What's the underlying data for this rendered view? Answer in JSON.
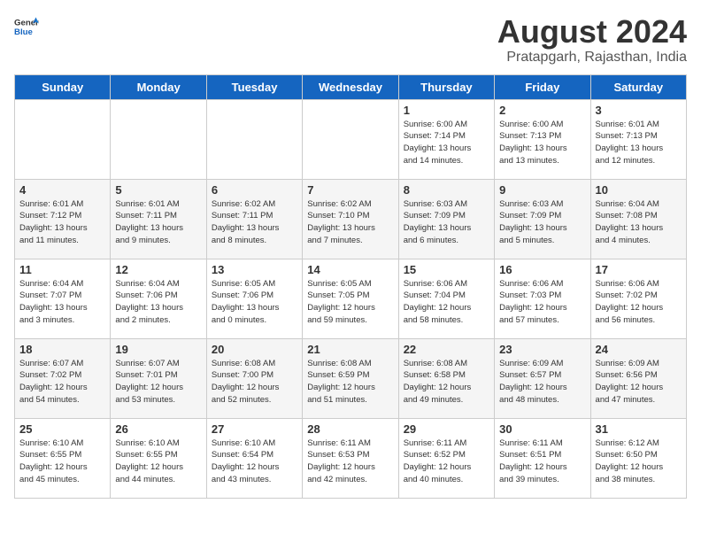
{
  "header": {
    "logo_general": "General",
    "logo_blue": "Blue",
    "title": "August 2024",
    "subtitle": "Pratapgarh, Rajasthan, India"
  },
  "days_of_week": [
    "Sunday",
    "Monday",
    "Tuesday",
    "Wednesday",
    "Thursday",
    "Friday",
    "Saturday"
  ],
  "rows": [
    {
      "alt": false,
      "cells": [
        {
          "day": "",
          "info": ""
        },
        {
          "day": "",
          "info": ""
        },
        {
          "day": "",
          "info": ""
        },
        {
          "day": "",
          "info": ""
        },
        {
          "day": "1",
          "info": "Sunrise: 6:00 AM\nSunset: 7:14 PM\nDaylight: 13 hours\nand 14 minutes."
        },
        {
          "day": "2",
          "info": "Sunrise: 6:00 AM\nSunset: 7:13 PM\nDaylight: 13 hours\nand 13 minutes."
        },
        {
          "day": "3",
          "info": "Sunrise: 6:01 AM\nSunset: 7:13 PM\nDaylight: 13 hours\nand 12 minutes."
        }
      ]
    },
    {
      "alt": true,
      "cells": [
        {
          "day": "4",
          "info": "Sunrise: 6:01 AM\nSunset: 7:12 PM\nDaylight: 13 hours\nand 11 minutes."
        },
        {
          "day": "5",
          "info": "Sunrise: 6:01 AM\nSunset: 7:11 PM\nDaylight: 13 hours\nand 9 minutes."
        },
        {
          "day": "6",
          "info": "Sunrise: 6:02 AM\nSunset: 7:11 PM\nDaylight: 13 hours\nand 8 minutes."
        },
        {
          "day": "7",
          "info": "Sunrise: 6:02 AM\nSunset: 7:10 PM\nDaylight: 13 hours\nand 7 minutes."
        },
        {
          "day": "8",
          "info": "Sunrise: 6:03 AM\nSunset: 7:09 PM\nDaylight: 13 hours\nand 6 minutes."
        },
        {
          "day": "9",
          "info": "Sunrise: 6:03 AM\nSunset: 7:09 PM\nDaylight: 13 hours\nand 5 minutes."
        },
        {
          "day": "10",
          "info": "Sunrise: 6:04 AM\nSunset: 7:08 PM\nDaylight: 13 hours\nand 4 minutes."
        }
      ]
    },
    {
      "alt": false,
      "cells": [
        {
          "day": "11",
          "info": "Sunrise: 6:04 AM\nSunset: 7:07 PM\nDaylight: 13 hours\nand 3 minutes."
        },
        {
          "day": "12",
          "info": "Sunrise: 6:04 AM\nSunset: 7:06 PM\nDaylight: 13 hours\nand 2 minutes."
        },
        {
          "day": "13",
          "info": "Sunrise: 6:05 AM\nSunset: 7:06 PM\nDaylight: 13 hours\nand 0 minutes."
        },
        {
          "day": "14",
          "info": "Sunrise: 6:05 AM\nSunset: 7:05 PM\nDaylight: 12 hours\nand 59 minutes."
        },
        {
          "day": "15",
          "info": "Sunrise: 6:06 AM\nSunset: 7:04 PM\nDaylight: 12 hours\nand 58 minutes."
        },
        {
          "day": "16",
          "info": "Sunrise: 6:06 AM\nSunset: 7:03 PM\nDaylight: 12 hours\nand 57 minutes."
        },
        {
          "day": "17",
          "info": "Sunrise: 6:06 AM\nSunset: 7:02 PM\nDaylight: 12 hours\nand 56 minutes."
        }
      ]
    },
    {
      "alt": true,
      "cells": [
        {
          "day": "18",
          "info": "Sunrise: 6:07 AM\nSunset: 7:02 PM\nDaylight: 12 hours\nand 54 minutes."
        },
        {
          "day": "19",
          "info": "Sunrise: 6:07 AM\nSunset: 7:01 PM\nDaylight: 12 hours\nand 53 minutes."
        },
        {
          "day": "20",
          "info": "Sunrise: 6:08 AM\nSunset: 7:00 PM\nDaylight: 12 hours\nand 52 minutes."
        },
        {
          "day": "21",
          "info": "Sunrise: 6:08 AM\nSunset: 6:59 PM\nDaylight: 12 hours\nand 51 minutes."
        },
        {
          "day": "22",
          "info": "Sunrise: 6:08 AM\nSunset: 6:58 PM\nDaylight: 12 hours\nand 49 minutes."
        },
        {
          "day": "23",
          "info": "Sunrise: 6:09 AM\nSunset: 6:57 PM\nDaylight: 12 hours\nand 48 minutes."
        },
        {
          "day": "24",
          "info": "Sunrise: 6:09 AM\nSunset: 6:56 PM\nDaylight: 12 hours\nand 47 minutes."
        }
      ]
    },
    {
      "alt": false,
      "cells": [
        {
          "day": "25",
          "info": "Sunrise: 6:10 AM\nSunset: 6:55 PM\nDaylight: 12 hours\nand 45 minutes."
        },
        {
          "day": "26",
          "info": "Sunrise: 6:10 AM\nSunset: 6:55 PM\nDaylight: 12 hours\nand 44 minutes."
        },
        {
          "day": "27",
          "info": "Sunrise: 6:10 AM\nSunset: 6:54 PM\nDaylight: 12 hours\nand 43 minutes."
        },
        {
          "day": "28",
          "info": "Sunrise: 6:11 AM\nSunset: 6:53 PM\nDaylight: 12 hours\nand 42 minutes."
        },
        {
          "day": "29",
          "info": "Sunrise: 6:11 AM\nSunset: 6:52 PM\nDaylight: 12 hours\nand 40 minutes."
        },
        {
          "day": "30",
          "info": "Sunrise: 6:11 AM\nSunset: 6:51 PM\nDaylight: 12 hours\nand 39 minutes."
        },
        {
          "day": "31",
          "info": "Sunrise: 6:12 AM\nSunset: 6:50 PM\nDaylight: 12 hours\nand 38 minutes."
        }
      ]
    }
  ]
}
